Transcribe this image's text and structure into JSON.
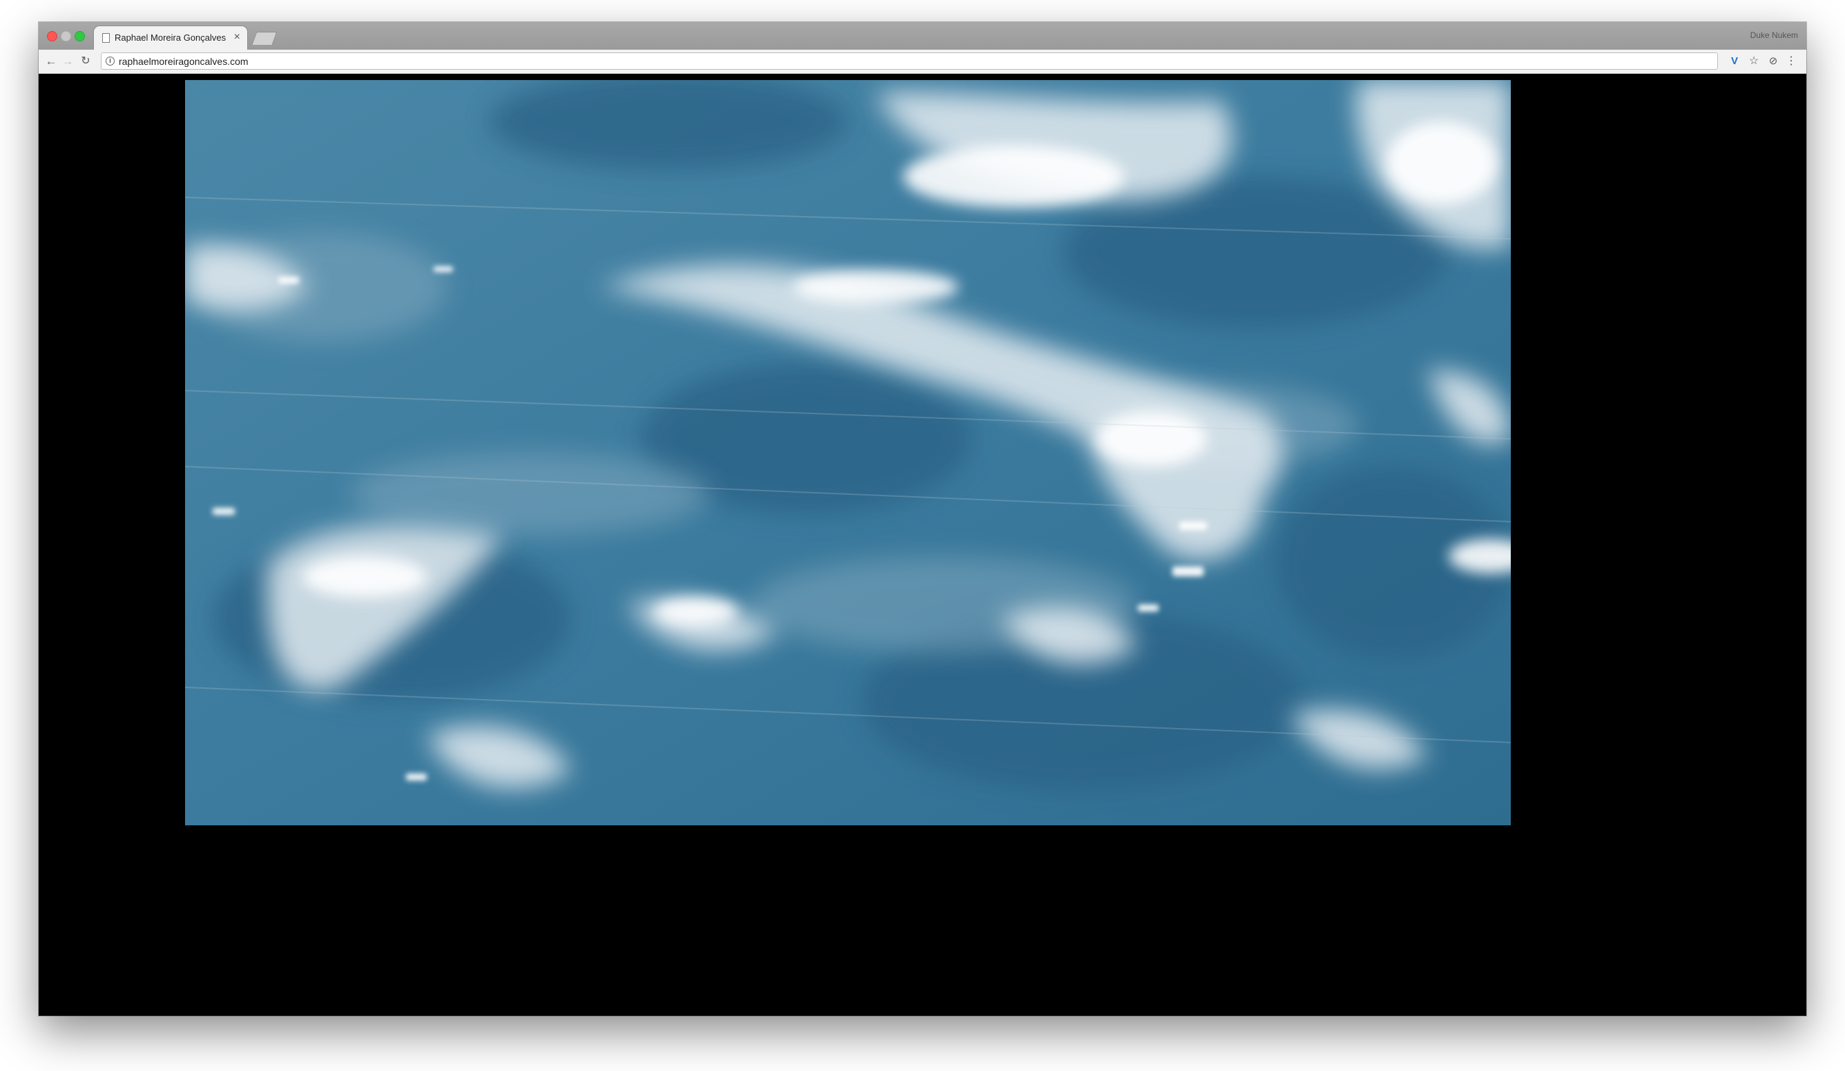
{
  "browser": {
    "tab": {
      "title": "Raphael Moreira Gonçalves",
      "close_glyph": "×"
    },
    "profile_name": "Duke Nukem",
    "nav": {
      "back_glyph": "←",
      "forward_glyph": "→",
      "reload_glyph": "↻"
    },
    "address_bar": {
      "url": "raphaelmoreiragoncalves.com",
      "info_glyph": "i"
    },
    "toolbar_icons": {
      "extension_v_glyph": "V",
      "bookmark_star_glyph": "☆",
      "extension_circle_glyph": "⊘",
      "menu_glyph": "⋮"
    }
  },
  "page": {
    "media": {
      "description_icon": "water-video",
      "colors": {
        "water_dark": "#2f6e92",
        "water_mid": "#4f8aa8",
        "foam": "#e8eef2",
        "background": "#000000"
      }
    }
  }
}
